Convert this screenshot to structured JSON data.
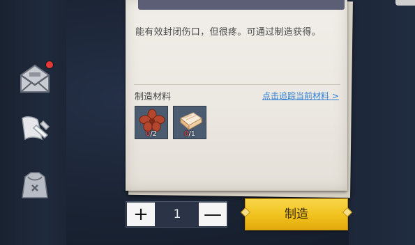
{
  "item": {
    "description": "能有效封闭伤口，但很疼。可通过制造获得。"
  },
  "materials": {
    "label": "制造材料",
    "track_link": "点击追踪当前材料 >",
    "items": [
      {
        "icon": "red-flower-icon",
        "have": "0",
        "need": "/2"
      },
      {
        "icon": "cloth-bandage-icon",
        "have": "0",
        "need": "/1"
      }
    ]
  },
  "quantity": {
    "plus": "+",
    "value": "1",
    "minus": "—"
  },
  "craft_button": "制造",
  "sidebar": {
    "icons": [
      "mail-icon",
      "crafting-scroll-icon",
      "backpack-icon"
    ],
    "mail_notification": true
  },
  "colors": {
    "accent": "#f1c21d",
    "link": "#2f7fd4",
    "missing": "#ff4040"
  }
}
